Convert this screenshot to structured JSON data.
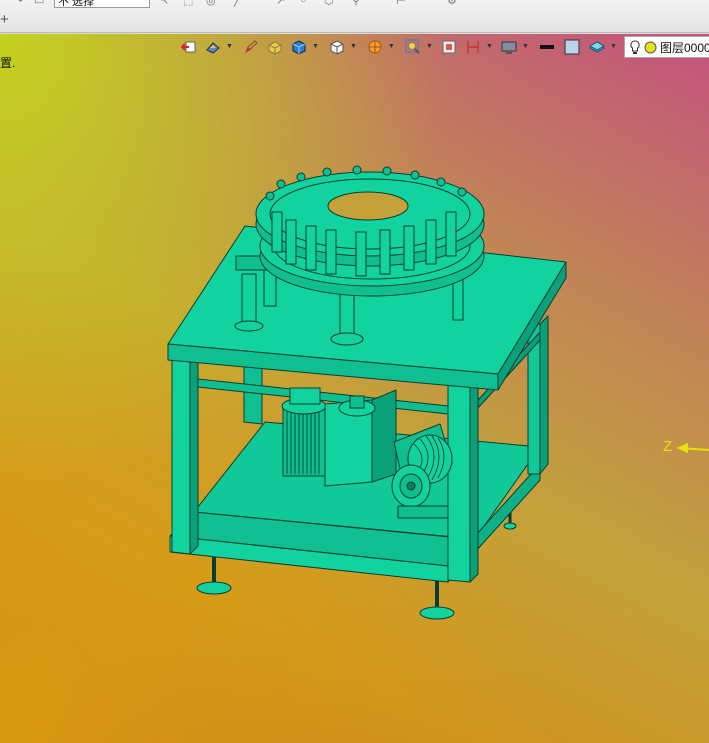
{
  "topbar": {
    "filter_value": "不 选择",
    "plus_label": "+"
  },
  "viewport": {
    "prompt": "置."
  },
  "toolbar": {
    "icons": [
      "exit-sketch-icon",
      "render-mode-icon",
      "pencil-icon",
      "box-yellow-icon",
      "solid-cube-icon",
      "wireframe-cube-icon",
      "section-icon",
      "zoom-view-icon",
      "frame-icon",
      "dimension-icon",
      "display-icon",
      "line-style-icon",
      "color-swatch-icon",
      "layer-style-icon"
    ]
  },
  "layer": {
    "name": "图层0000",
    "icons": [
      "lightbulb-icon",
      "layer-color-icon"
    ]
  },
  "axis": {
    "z_label": "Z"
  },
  "colors": {
    "model": "#12d3a0",
    "model_edge": "#0a3d30",
    "axis": "#e8e000"
  }
}
